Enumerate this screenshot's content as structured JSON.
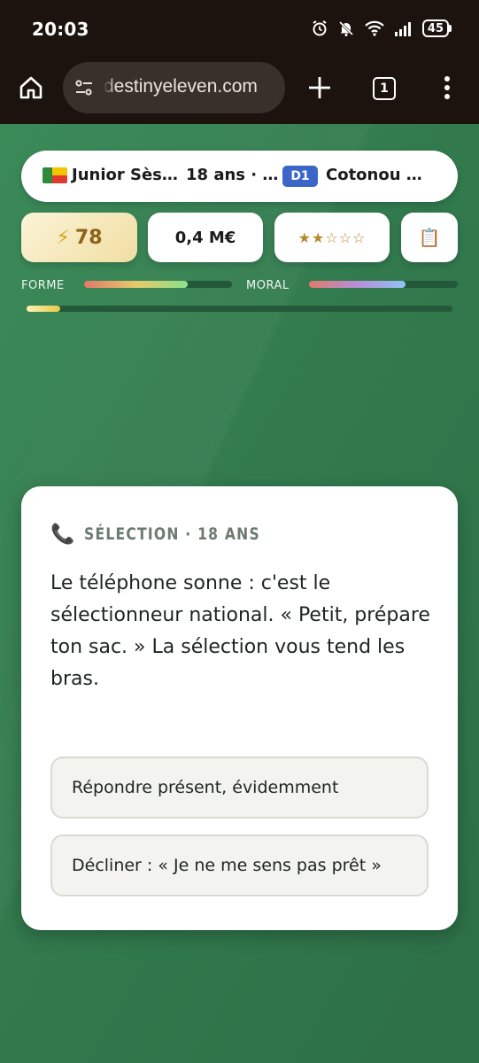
{
  "status_bar": {
    "time": "20:03",
    "battery": "45",
    "icons": [
      "alarm-icon",
      "bell-off-icon",
      "wifi-icon",
      "signal-icon",
      "battery-icon"
    ]
  },
  "browser": {
    "url": "destinyeleven.com",
    "tab_count": "1",
    "icons": [
      "home-icon",
      "site-settings-icon",
      "new-tab-plus-icon",
      "tab-switcher-icon",
      "menu-kebab-icon"
    ]
  },
  "player": {
    "name": "Junior Sès…",
    "age": "18 ans · …",
    "division": "D1",
    "club": "Cotonou …",
    "flag_colors": [
      "#2e8b3d",
      "#f2c500",
      "#e03a2f"
    ]
  },
  "stats": {
    "energy": "78",
    "value": "0,4 M€",
    "stars": "★★☆☆☆",
    "stars_filled": 2,
    "stars_total": 5
  },
  "gauges": {
    "forme": {
      "label": "FORME",
      "level": 0.7
    },
    "moral": {
      "label": "MORAL",
      "level": 0.65
    },
    "career_progress": 0.08
  },
  "event": {
    "tag": "SÉLECTION · 18 ANS",
    "text": "Le téléphone sonne : c'est le sélectionneur national. « Petit, prépare ton sac. » La sélection vous tend les bras.",
    "choices": [
      {
        "label": "Répondre présent, évidemment"
      },
      {
        "label": "Décliner : « Je ne me sens pas prêt »"
      }
    ]
  },
  "colors": {
    "page_green": "#2f6e47",
    "chrome": "#1c130e",
    "division_badge": "#3b66c9",
    "energy_gold": "#8b6318"
  }
}
